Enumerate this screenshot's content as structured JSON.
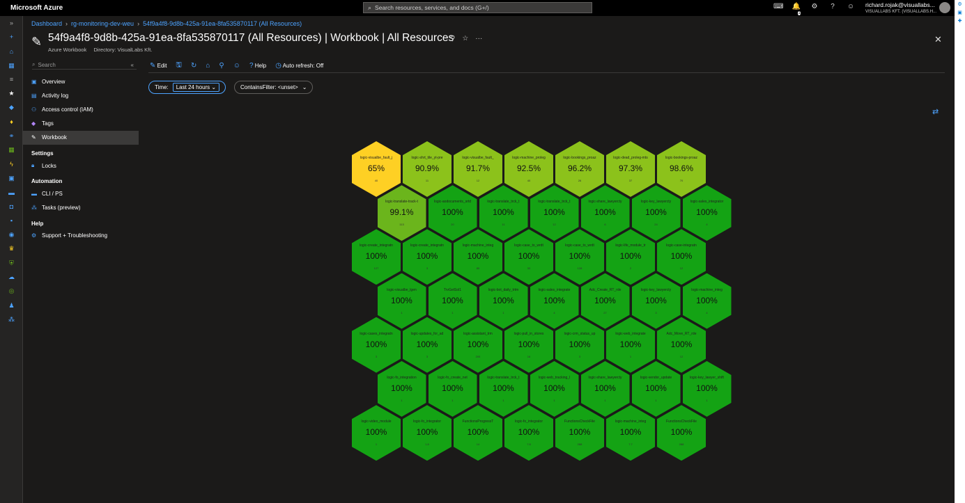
{
  "topbar": {
    "brand": "Microsoft Azure",
    "search_placeholder": "Search resources, services, and docs (G+/)",
    "notification_count": "1",
    "user_email": "richard.rojak@visuallabs...",
    "user_tenant": "VISUALLABS KFT. (VISUALLABS.H..."
  },
  "breadcrumb": [
    "Dashboard",
    "rg-monitoring-dev-weu",
    "54f9a4f8-9d8b-425a-91ea-8fa535870117 (All Resources)"
  ],
  "header": {
    "title": "54f9a4f8-9d8b-425a-91ea-8fa535870117 (All Resources) | Workbook | All Resources",
    "type": "Azure Workbook",
    "directory": "Directory: VisualLabs Kft."
  },
  "resource_menu": {
    "search_placeholder": "Search",
    "items": [
      {
        "label": "Overview",
        "icon": "overview-icon"
      },
      {
        "label": "Activity log",
        "icon": "activity-log-icon"
      },
      {
        "label": "Access control (IAM)",
        "icon": "iam-icon"
      },
      {
        "label": "Tags",
        "icon": "tag-icon"
      },
      {
        "label": "Workbook",
        "icon": "pencil-icon"
      }
    ],
    "sections": [
      {
        "heading": "Settings",
        "items": [
          {
            "label": "Locks",
            "icon": "lock-icon"
          }
        ]
      },
      {
        "heading": "Automation",
        "items": [
          {
            "label": "CLI / PS",
            "icon": "cli-icon"
          },
          {
            "label": "Tasks (preview)",
            "icon": "tasks-icon"
          }
        ]
      },
      {
        "heading": "Help",
        "items": [
          {
            "label": "Support + Troubleshooting",
            "icon": "support-icon"
          }
        ]
      }
    ]
  },
  "toolbar": {
    "edit": "Edit",
    "help": "Help",
    "auto_refresh": "Auto refresh: Off"
  },
  "parameters": {
    "time_label": "Time:",
    "time_value": "Last 24 hours",
    "filter_label": "ContainsFilter: <unset>"
  },
  "colors": {
    "full": "#14a314",
    "high": "#5fb31d",
    "mid": "#8cc21b",
    "low": "#fed024"
  },
  "tiles": [
    [
      {
        "name": "logic-visualbe_fault_j",
        "value": "65%",
        "color": "#fed024",
        "count": "40"
      },
      {
        "name": "logic-shrt_tile_yt-pre",
        "value": "90.9%",
        "color": "#8cc21b",
        "count": "11"
      },
      {
        "name": "logic-visualbe_fault_",
        "value": "91.7%",
        "color": "#8cc21b",
        "count": "12"
      },
      {
        "name": "logic-machine_proleg",
        "value": "92.5%",
        "color": "#8cc21b",
        "count": "40"
      },
      {
        "name": "logic-bookings_proaz",
        "value": "96.2%",
        "color": "#8cc21b",
        "count": "26"
      },
      {
        "name": "logic-dead_proleg-mts",
        "value": "97.3%",
        "color": "#8cc21b",
        "count": "37"
      },
      {
        "name": "logic-bookings-proaz",
        "value": "98.6%",
        "color": "#8cc21b",
        "count": "70"
      }
    ],
    [
      {
        "name": "logic-translate-track-t",
        "value": "99.1%",
        "color": "#6bb51c",
        "count": "113"
      },
      {
        "name": "logic-aodocuments_srtd",
        "value": "100%",
        "color": "#14a314",
        "count": "20"
      },
      {
        "name": "logic-translate_trck_t",
        "value": "100%",
        "color": "#14a314",
        "count": "11"
      },
      {
        "name": "logic-translate_trck_t",
        "value": "100%",
        "color": "#14a314",
        "count": "12"
      },
      {
        "name": "logic-share_lawyercty",
        "value": "100%",
        "color": "#14a314",
        "count": "6"
      },
      {
        "name": "logic-key_lawyercty",
        "value": "100%",
        "color": "#14a314",
        "count": "24"
      },
      {
        "name": "logic-sales_integrator",
        "value": "100%",
        "color": "#14a314",
        "count": "4"
      }
    ],
    [
      {
        "name": "logic-create_integratn",
        "value": "100%",
        "color": "#14a314",
        "count": "127"
      },
      {
        "name": "logic-create_integratn",
        "value": "100%",
        "color": "#14a314",
        "count": "3"
      },
      {
        "name": "logic-machine_integ",
        "value": "100%",
        "color": "#14a314",
        "count": "85"
      },
      {
        "name": "logic-case_to_wrdt",
        "value": "100%",
        "color": "#14a314",
        "count": "33"
      },
      {
        "name": "logic-case_to_wrdt",
        "value": "100%",
        "color": "#14a314",
        "count": "128"
      },
      {
        "name": "logic-life_module_tr",
        "value": "100%",
        "color": "#14a314",
        "count": "2"
      },
      {
        "name": "logic-case-integratn",
        "value": "100%",
        "color": "#14a314",
        "count": "12"
      }
    ],
    [
      {
        "name": "logic-visualbe_lgen",
        "value": "100%",
        "color": "#14a314",
        "count": "1"
      },
      {
        "name": "TrvGetSol1",
        "value": "100%",
        "color": "#14a314",
        "count": "1"
      },
      {
        "name": "logic-bot_daily_trtm",
        "value": "100%",
        "color": "#14a314",
        "count": "1"
      },
      {
        "name": "logic-sales_integrate",
        "value": "100%",
        "color": "#14a314",
        "count": "4"
      },
      {
        "name": "Adc_Create_RT_rde",
        "value": "100%",
        "color": "#14a314",
        "count": "27"
      },
      {
        "name": "logic-key_lawyercty",
        "value": "100%",
        "color": "#14a314",
        "count": "3"
      },
      {
        "name": "logic-machine_integ",
        "value": "100%",
        "color": "#14a314",
        "count": "4"
      }
    ],
    [
      {
        "name": "logic-cases_integratn",
        "value": "100%",
        "color": "#14a314",
        "count": "3"
      },
      {
        "name": "logic-updates_for_ad",
        "value": "100%",
        "color": "#14a314",
        "count": "3"
      },
      {
        "name": "logic-assistant_trm",
        "value": "100%",
        "color": "#14a314",
        "count": "205"
      },
      {
        "name": "logic-pull_in_stores",
        "value": "100%",
        "color": "#14a314",
        "count": "16"
      },
      {
        "name": "logic-crm_status_up",
        "value": "100%",
        "color": "#14a314",
        "count": "3"
      },
      {
        "name": "logic-web_integrate",
        "value": "100%",
        "color": "#14a314",
        "count": "1"
      },
      {
        "name": "Adc_Move_RT_rde",
        "value": "100%",
        "color": "#14a314",
        "count": "12"
      }
    ],
    [
      {
        "name": "logic-fo_integration",
        "value": "100%",
        "color": "#14a314",
        "count": "1"
      },
      {
        "name": "logic-fo_create_net",
        "value": "100%",
        "color": "#14a314",
        "count": "1"
      },
      {
        "name": "logic-translate_trck_t",
        "value": "100%",
        "color": "#14a314",
        "count": "1"
      },
      {
        "name": "logic-web_tracking_l",
        "value": "100%",
        "color": "#14a314",
        "count": "1"
      },
      {
        "name": "logic-share_lawyercty",
        "value": "100%",
        "color": "#14a314",
        "count": "1"
      },
      {
        "name": "logic-vendor_update",
        "value": "100%",
        "color": "#14a314",
        "count": "1"
      },
      {
        "name": "logic-key_lawyer_shift",
        "value": "100%",
        "color": "#14a314",
        "count": "1"
      }
    ],
    [
      {
        "name": "logic-video_module",
        "value": "100%",
        "color": "#14a314",
        "count": "1"
      },
      {
        "name": "logic-fo_integrator",
        "value": "100%",
        "color": "#14a314",
        "count": "1.8"
      },
      {
        "name": "FunctionsProgressT",
        "value": "100%",
        "color": "#14a314",
        "count": "14"
      },
      {
        "name": "logic-fo_integrator",
        "value": "100%",
        "color": "#14a314",
        "count": "7.8"
      },
      {
        "name": "FunctionsCheckFile",
        "value": "100%",
        "color": "#14a314",
        "count": "288"
      },
      {
        "name": "logic-machine_integ",
        "value": "100%",
        "color": "#14a314",
        "count": "7.7"
      },
      {
        "name": "FunctionsCheckFile",
        "value": "100%",
        "color": "#14a314",
        "count": "288"
      }
    ]
  ]
}
